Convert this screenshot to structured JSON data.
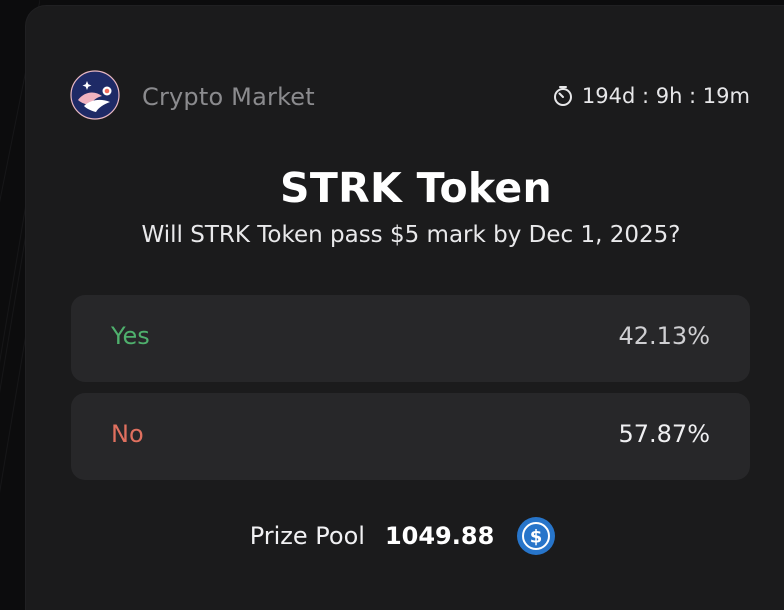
{
  "header": {
    "category": "Crypto Market",
    "countdown": "194d : 9h : 19m",
    "logo_icon": "crypto-market-logo",
    "timer_icon": "timer-icon"
  },
  "market": {
    "title": "STRK Token",
    "question": "Will STRK Token pass $5 mark by Dec 1, 2025?"
  },
  "options": [
    {
      "label": "Yes",
      "value": "42.13%",
      "color": "#4fb06d"
    },
    {
      "label": "No",
      "value": "57.87%",
      "color": "#e0705f"
    }
  ],
  "prize_pool": {
    "label": "Prize Pool",
    "amount": "1049.88",
    "currency_icon": "usdc-icon",
    "currency_color": "#2775ca"
  }
}
